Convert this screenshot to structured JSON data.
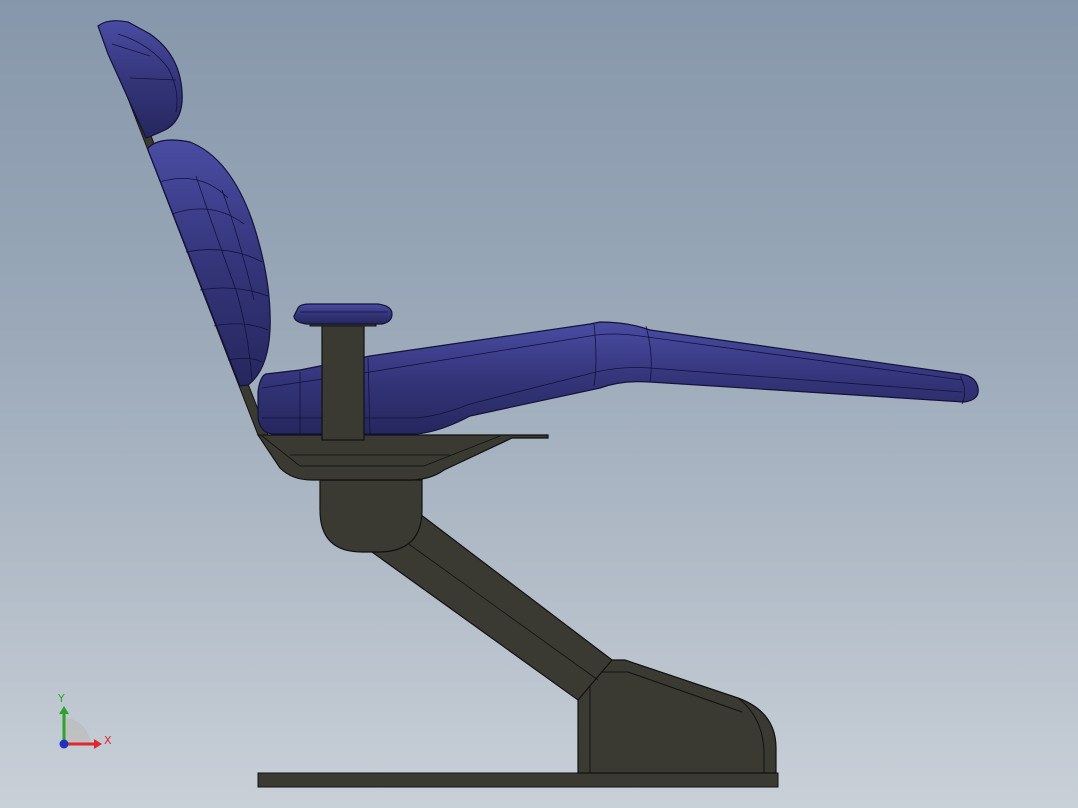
{
  "viewport": {
    "background_top": "#8797ab",
    "background_bottom": "#c9d0d8"
  },
  "model": {
    "upholstery_color": "#34357a",
    "upholstery_edge": "#12123a",
    "frame_color": "#3a3a32",
    "frame_edge": "#111111"
  },
  "triad": {
    "x_label": "X",
    "y_label": "Y",
    "x_color": "#e0262e",
    "y_color": "#2aa52a",
    "z_color": "#2030c0"
  }
}
